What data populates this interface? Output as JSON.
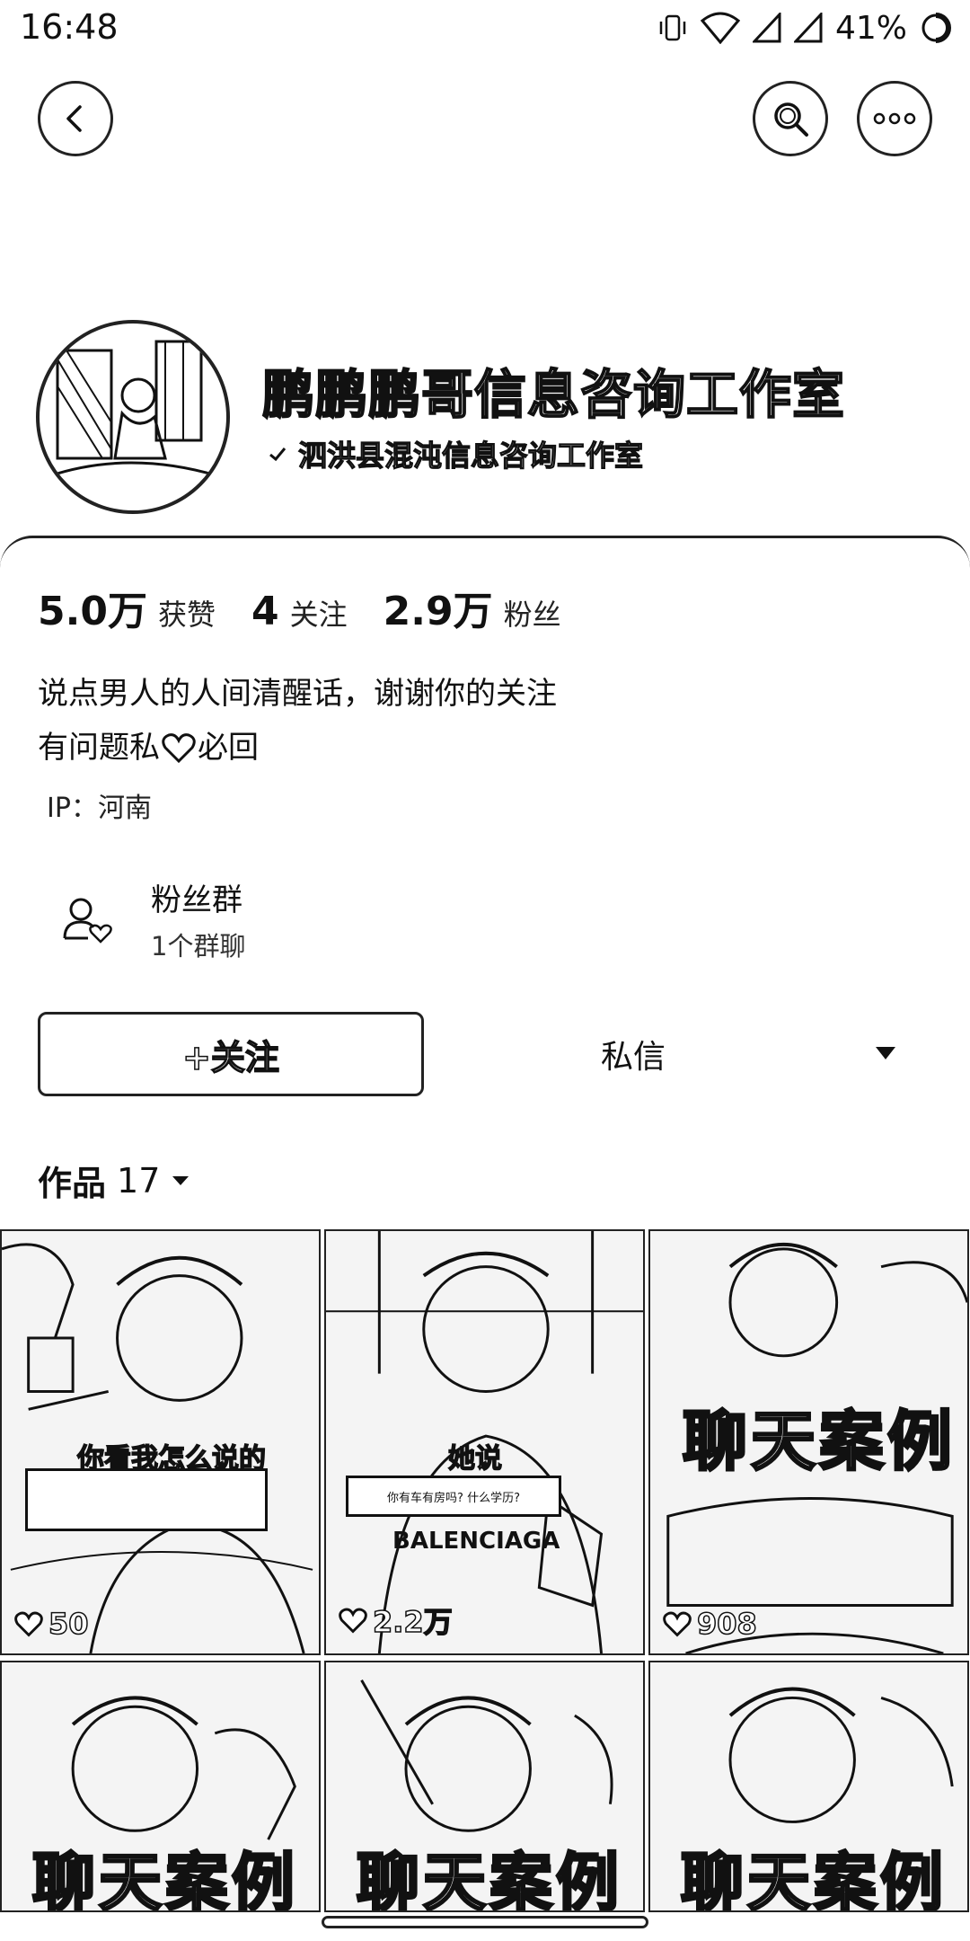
{
  "status_bar": {
    "time": "16:48",
    "battery_percent": "41%",
    "icons": [
      "vibrate-icon",
      "wifi-icon",
      "signal-icon",
      "signal-icon",
      "battery-icon"
    ]
  },
  "header": {
    "back_icon": "back-arrow-icon",
    "search_icon": "search-icon",
    "more_icon": "more-icon"
  },
  "profile": {
    "nickname": "鹏鹏鹏哥信息咨询工作室",
    "verified_text": "泗洪县混沌信息咨询工作室",
    "stats": [
      {
        "value": "5.0万",
        "label": "获赞"
      },
      {
        "value": "4",
        "label": "关注"
      },
      {
        "value": "2.9万",
        "label": "粉丝"
      }
    ],
    "bio_lines": [
      "说点男人的人间清醒话，谢谢你的关注",
      "有问题私",
      "必回"
    ],
    "ip": "IP：河南"
  },
  "fan_group": {
    "title": "粉丝群",
    "subtitle": "1个群聊"
  },
  "actions": {
    "follow_label": "+关注",
    "message_label": "私信"
  },
  "works": {
    "label": "作品",
    "count": "17",
    "items": [
      {
        "caption": "你看我怎么说的",
        "likes": "50"
      },
      {
        "caption": "她说",
        "likes": "2.2万",
        "box_text": "你有车有房吗? 什么学历?",
        "shirt_text": "BALENCIAGA"
      },
      {
        "banner": "聊天案例",
        "likes": "908"
      },
      {
        "banner": "聊天案例"
      },
      {
        "banner": "聊天案例"
      },
      {
        "banner": "聊天案例"
      }
    ]
  }
}
